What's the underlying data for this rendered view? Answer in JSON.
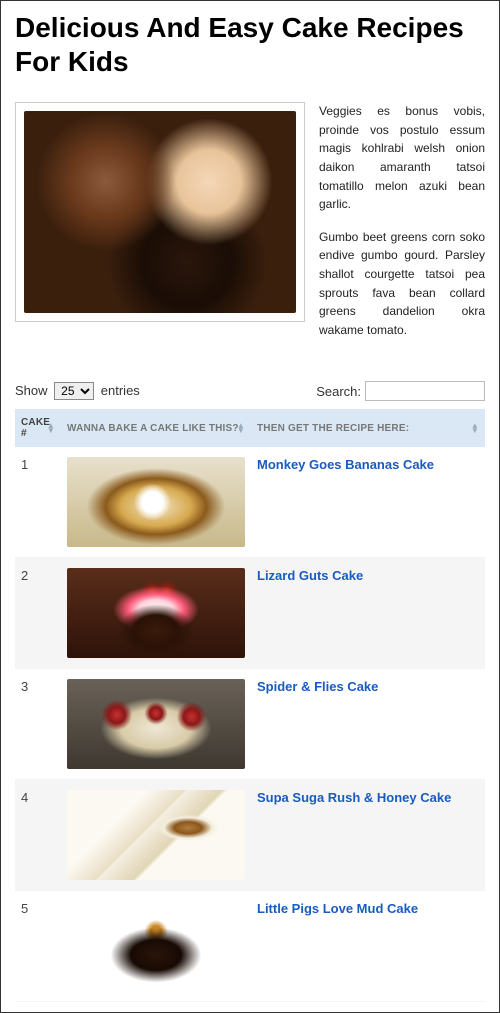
{
  "title": "Delicious And Easy Cake Recipes For Kids",
  "intro": {
    "p1": "Veggies es bonus vobis, proinde vos postulo essum magis kohlrabi welsh onion daikon amaranth tatsoi tomatillo melon azuki bean garlic.",
    "p2": "Gumbo beet greens corn soko endive gumbo gourd. Parsley shallot courgette tatsoi pea sprouts fava bean collard greens dandelion okra wakame tomato."
  },
  "controls": {
    "show_prefix": "Show",
    "show_suffix": "entries",
    "page_size": "25",
    "search_label": "Search:"
  },
  "columns": {
    "num": "Cake #",
    "img": "Wanna bake a cake like this?",
    "recipe": "Then get the recipe here:"
  },
  "rows": [
    {
      "n": "1",
      "recipe": "Monkey Goes Bananas Cake"
    },
    {
      "n": "2",
      "recipe": "Lizard Guts Cake"
    },
    {
      "n": "3",
      "recipe": "Spider & Flies Cake"
    },
    {
      "n": "4",
      "recipe": "Supa Suga Rush & Honey Cake"
    },
    {
      "n": "5",
      "recipe": "Little Pigs Love Mud Cake"
    }
  ]
}
